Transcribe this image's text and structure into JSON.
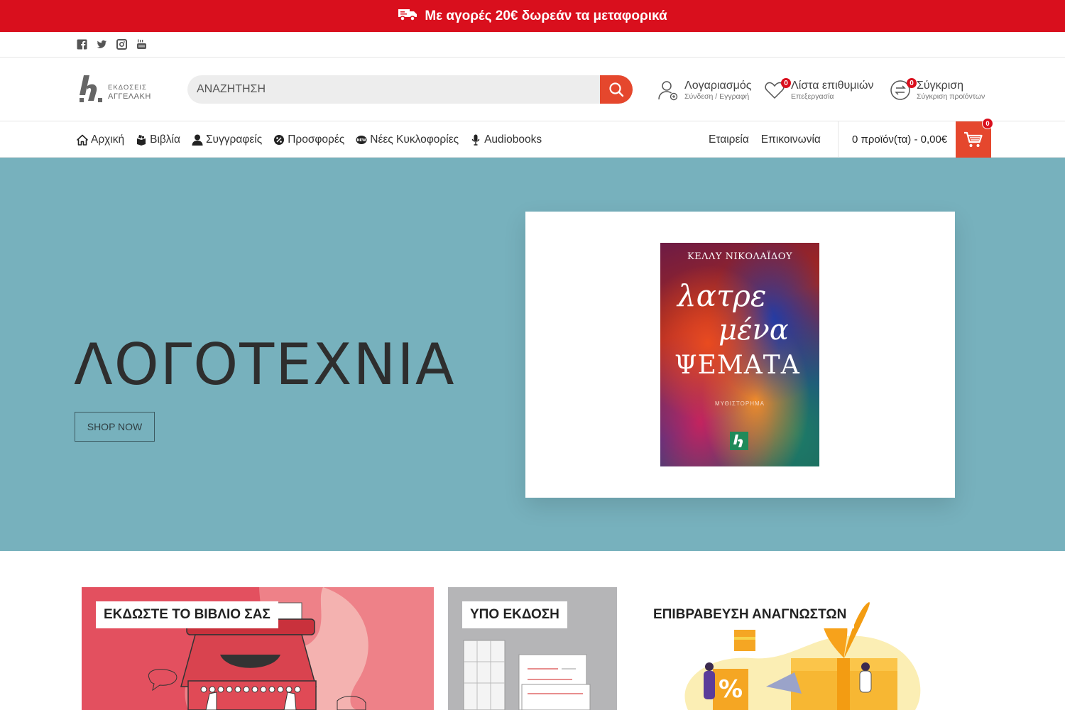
{
  "promo": {
    "text": "Με αγορές 20€ δωρεάν τα μεταφορικά",
    "icon": "truck-icon"
  },
  "social": [
    "facebook-icon",
    "twitter-icon",
    "instagram-icon",
    "youtube-icon"
  ],
  "logo": {
    "line1": "ΕΚΔΟΣΕΙΣ",
    "line2": "ΑΓΓΕΛΑΚΗ"
  },
  "search": {
    "placeholder": "ΑΝΑΖΗΤΗΣΗ"
  },
  "account": {
    "title": "Λογαριασμός",
    "subtitle": "Σύνδεση / Εγγραφή"
  },
  "wishlist": {
    "title": "Λίστα επιθυμιών",
    "subtitle": "Επεξεργασία",
    "count": "0"
  },
  "compare": {
    "title": "Σύγκριση",
    "subtitle": "Σύγκριση προϊόντων",
    "count": "0"
  },
  "nav": {
    "items": [
      {
        "label": "Αρχική",
        "icon": "home-icon"
      },
      {
        "label": "Βιβλία",
        "icon": "books-icon"
      },
      {
        "label": "Συγγραφείς",
        "icon": "user-icon"
      },
      {
        "label": "Προσφορές",
        "icon": "offers-icon"
      },
      {
        "label": "Νέες Κυκλοφορίες",
        "icon": "new-icon"
      },
      {
        "label": "Audiobooks",
        "icon": "microphone-icon"
      }
    ],
    "right": [
      "Εταιρεία",
      "Επικοινωνία"
    ]
  },
  "cart": {
    "summary": "0 προϊόν(τα) - 0,00€",
    "count": "0"
  },
  "hero": {
    "title": "ΛΟΓΟΤΕΧΝΙΑ",
    "button": "SHOP NOW",
    "book": {
      "author": "ΚΕΛΛΥ ΝΙΚΟΛΑΪΔΟΥ",
      "title_line1": "λατρε",
      "title_line2": "μένα",
      "title_line3": "ΨΕΜΑΤΑ",
      "genre": "ΜΥΘΙΣΤΟΡΗΜΑ"
    }
  },
  "tiles": [
    {
      "label": "ΕΚΔΩΣΤΕ ΤΟ ΒΙΒΛΙΟ ΣΑΣ"
    },
    {
      "label": "ΥΠΟ ΕΚΔΟΣΗ"
    },
    {
      "label": "ΕΠΙΒΡΑΒΕΥΣΗ ΑΝΑΓΝΩΣΤΩΝ"
    }
  ],
  "colors": {
    "promo_red": "#d90f1d",
    "accent_orange": "#e5472d",
    "hero_bg": "#77b1bd"
  }
}
